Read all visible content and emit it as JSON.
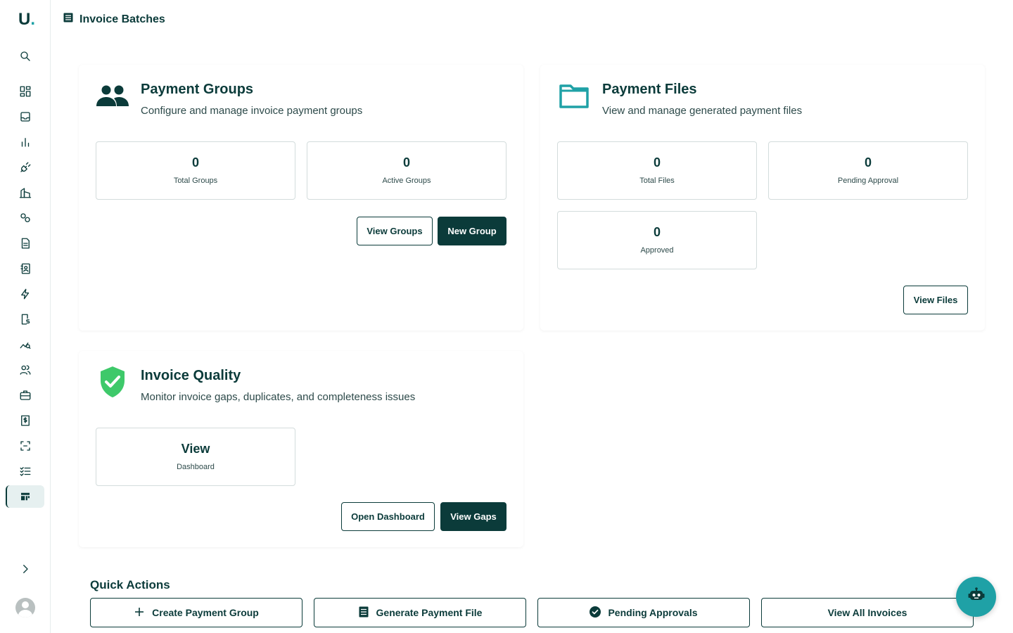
{
  "app": {
    "logo": "U",
    "logo_dot": "."
  },
  "header": {
    "title": "Invoice Batches"
  },
  "sidebar": {
    "items": [
      {
        "icon": "search-icon"
      },
      {
        "icon": "dashboard-icon"
      },
      {
        "icon": "inbox-icon"
      },
      {
        "icon": "bar-chart-icon"
      },
      {
        "icon": "plug-icon"
      },
      {
        "icon": "building-icon"
      },
      {
        "icon": "locations-icon"
      },
      {
        "icon": "document-icon"
      },
      {
        "icon": "contacts-icon"
      },
      {
        "icon": "lightning-icon"
      },
      {
        "icon": "invoice-dollar-icon"
      },
      {
        "icon": "analytics-icon"
      },
      {
        "icon": "users-icon"
      },
      {
        "icon": "briefcase-icon"
      },
      {
        "icon": "receipt-icon"
      },
      {
        "icon": "scan-icon"
      },
      {
        "icon": "checklist-icon"
      },
      {
        "icon": "batches-icon"
      }
    ],
    "active_item": "batches-icon"
  },
  "payment_groups": {
    "title": "Payment Groups",
    "subtitle": "Configure and manage invoice payment groups",
    "icon": "people-icon",
    "stats": [
      {
        "value": "0",
        "label": "Total Groups"
      },
      {
        "value": "0",
        "label": "Active Groups"
      }
    ],
    "buttons": {
      "view": "View Groups",
      "new": "New Group"
    }
  },
  "payment_files": {
    "title": "Payment Files",
    "subtitle": "View and manage generated payment files",
    "icon": "folder-icon",
    "stats": [
      {
        "value": "0",
        "label": "Total Files"
      },
      {
        "value": "0",
        "label": "Pending Approval"
      },
      {
        "value": "0",
        "label": "Approved"
      }
    ],
    "buttons": {
      "view": "View Files"
    }
  },
  "invoice_quality": {
    "title": "Invoice Quality",
    "subtitle": "Monitor invoice gaps, duplicates, and completeness issues",
    "icon": "shield-check-icon",
    "stat": {
      "value": "View",
      "label": "Dashboard"
    },
    "buttons": {
      "open": "Open Dashboard",
      "gaps": "View Gaps"
    }
  },
  "quick_actions": {
    "title": "Quick Actions",
    "items": [
      {
        "label": "Create Payment Group",
        "icon": "plus-icon"
      },
      {
        "label": "Generate Payment File",
        "icon": "file-list-icon"
      },
      {
        "label": "Pending Approvals",
        "icon": "check-circle-icon"
      },
      {
        "label": "View All Invoices",
        "icon": ""
      }
    ]
  },
  "colors": {
    "primary": "#0b3b3a",
    "accent": "#1fa1a6",
    "success": "#3ec96a"
  }
}
